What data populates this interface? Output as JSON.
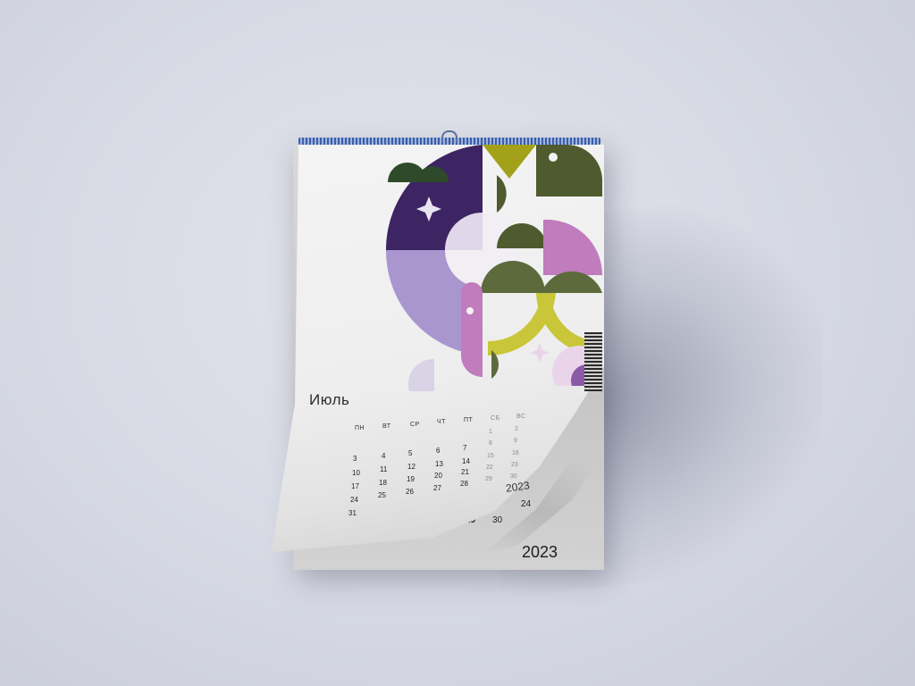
{
  "calendar": {
    "month": "Июль",
    "curl_year": "2023",
    "back_year": "2023",
    "weekdays": [
      "ПН",
      "ВТ",
      "СР",
      "ЧТ",
      "ПТ",
      "СБ",
      "ВС"
    ],
    "days": [
      "3",
      "4",
      "5",
      "6",
      "7",
      "1",
      "2",
      "10",
      "11",
      "12",
      "13",
      "14",
      "8",
      "9",
      "17",
      "18",
      "19",
      "20",
      "21",
      "15",
      "16",
      "24",
      "25",
      "26",
      "27",
      "28",
      "22",
      "23",
      "31",
      "29",
      "30"
    ],
    "back_days": [
      "28",
      "29",
      "30",
      "24"
    ]
  },
  "colors": {
    "purple_dark": "#3d2463",
    "purple_light": "#a996cf",
    "pink": "#c07cbc",
    "olive_dark": "#4f5a2e",
    "olive_green": "#5d6b3c",
    "mustard": "#a3a11a",
    "lime": "#c9c63a",
    "forest": "#2f4a2a"
  }
}
